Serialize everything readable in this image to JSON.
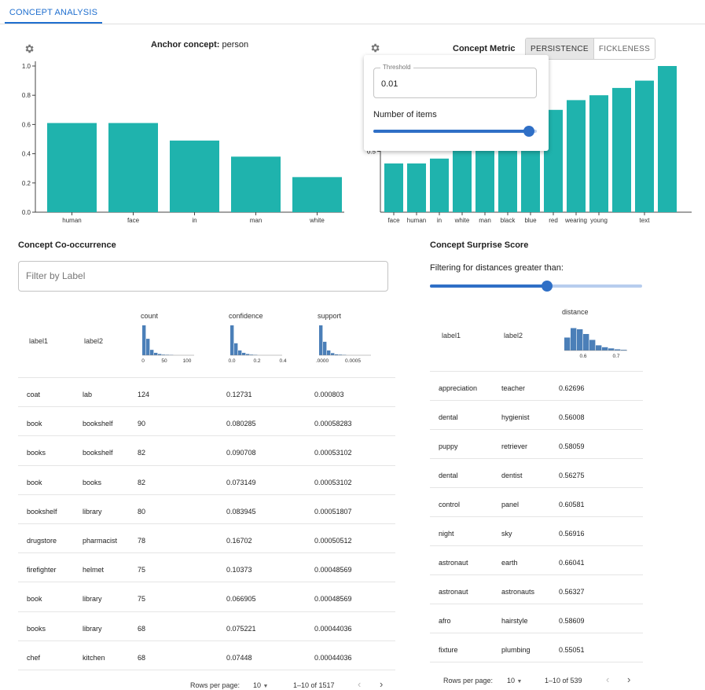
{
  "tabs": [
    {
      "label": "CONCEPT ANALYSIS"
    }
  ],
  "anchor": {
    "label": "Anchor concept:",
    "value": "person"
  },
  "metric": {
    "label": "Concept Metric",
    "options": [
      "PERSISTENCE",
      "FICKLENESS"
    ],
    "selected": "PERSISTENCE"
  },
  "popup": {
    "threshold_label": "Threshold",
    "threshold_value": "0.01",
    "items_label": "Number of items",
    "items_fraction": 0.95
  },
  "chart_data": [
    {
      "type": "bar",
      "categories": [
        "human",
        "face",
        "in",
        "man",
        "white"
      ],
      "values": [
        0.61,
        0.61,
        0.49,
        0.38,
        0.24
      ],
      "ylim": [
        0,
        1.0
      ],
      "yticks": [
        "0.0",
        "0.2",
        "0.4",
        "0.6",
        "0.8",
        "1.0"
      ]
    },
    {
      "type": "bar",
      "categories": [
        "face",
        "human",
        "in",
        "white",
        "man",
        "black",
        "blue",
        "red",
        "wearing",
        "young",
        "",
        "text"
      ],
      "values": [
        0.4,
        0.4,
        0.44,
        0.61,
        0.66,
        0.7,
        0.72,
        0.84,
        0.92,
        0.96,
        1.02,
        1.08,
        1.2
      ],
      "ylim": [
        0,
        1.2
      ],
      "yticks": [
        "0.5"
      ]
    }
  ],
  "cooc": {
    "title": "Concept Co-occurrence",
    "filter_placeholder": "Filter by Label",
    "columns": [
      "label1",
      "label2",
      "count",
      "confidence",
      "support"
    ],
    "hist": {
      "count": {
        "values": [
          1,
          0.55,
          0.18,
          0.08,
          0.04,
          0.02,
          0.015,
          0.01
        ],
        "ticks": [
          "0",
          "50",
          "100"
        ]
      },
      "confidence": {
        "values": [
          1,
          0.4,
          0.16,
          0.08,
          0.04,
          0.02,
          0.012
        ],
        "ticks": [
          "0.0",
          "0.2",
          "0.4"
        ]
      },
      "support": {
        "values": [
          1,
          0.45,
          0.16,
          0.07,
          0.03,
          0.02,
          0.012
        ],
        "ticks": [
          ".0000",
          "0.0005"
        ]
      }
    },
    "rows": [
      [
        "coat",
        "lab",
        "124",
        "0.12731",
        "0.000803"
      ],
      [
        "book",
        "bookshelf",
        "90",
        "0.080285",
        "0.00058283"
      ],
      [
        "books",
        "bookshelf",
        "82",
        "0.090708",
        "0.00053102"
      ],
      [
        "book",
        "books",
        "82",
        "0.073149",
        "0.00053102"
      ],
      [
        "bookshelf",
        "library",
        "80",
        "0.083945",
        "0.00051807"
      ],
      [
        "drugstore",
        "pharmacist",
        "78",
        "0.16702",
        "0.00050512"
      ],
      [
        "firefighter",
        "helmet",
        "75",
        "0.10373",
        "0.00048569"
      ],
      [
        "book",
        "library",
        "75",
        "0.066905",
        "0.00048569"
      ],
      [
        "books",
        "library",
        "68",
        "0.075221",
        "0.00044036"
      ],
      [
        "chef",
        "kitchen",
        "68",
        "0.07448",
        "0.00044036"
      ]
    ],
    "footer": {
      "rows_per_page_label": "Rows per page:",
      "rows_per_page": "10",
      "range": "1–10 of 1517"
    }
  },
  "surprise": {
    "title": "Concept Surprise Score",
    "filter_label": "Filtering for distances greater than:",
    "slider_fraction": 0.55,
    "columns": [
      "label1",
      "label2",
      "distance"
    ],
    "hist": {
      "values": [
        0.55,
        0.95,
        0.9,
        0.7,
        0.45,
        0.22,
        0.14,
        0.09,
        0.05,
        0.03
      ],
      "ticks": [
        "0.6",
        "0.7"
      ]
    },
    "rows": [
      [
        "appreciation",
        "teacher",
        "0.62696"
      ],
      [
        "dental",
        "hygienist",
        "0.56008"
      ],
      [
        "puppy",
        "retriever",
        "0.58059"
      ],
      [
        "dental",
        "dentist",
        "0.56275"
      ],
      [
        "control",
        "panel",
        "0.60581"
      ],
      [
        "night",
        "sky",
        "0.56916"
      ],
      [
        "astronaut",
        "earth",
        "0.66041"
      ],
      [
        "astronaut",
        "astronauts",
        "0.56327"
      ],
      [
        "afro",
        "hairstyle",
        "0.58609"
      ],
      [
        "fixture",
        "plumbing",
        "0.55051"
      ]
    ],
    "footer": {
      "rows_per_page_label": "Rows per page:",
      "rows_per_page": "10",
      "range": "1–10 of 539"
    }
  },
  "colors": {
    "accent": "#1f6fcf",
    "bar": "#1fb3ad",
    "hist": "#4b7fb8",
    "slider": "#2f6fc6"
  },
  "icons": {
    "settings": "gear-icon",
    "prev": "chevron-left-icon",
    "next": "chevron-right-icon",
    "dropdown": "caret-down-icon"
  }
}
